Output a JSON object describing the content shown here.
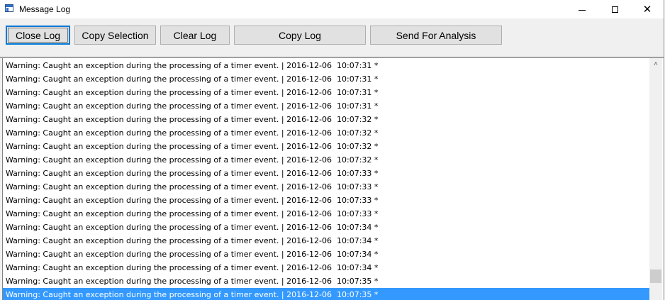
{
  "window": {
    "title": "Message Log",
    "controls": {
      "minimize": "minimize",
      "maximize": "maximize",
      "close": "✕"
    }
  },
  "toolbar": {
    "close_log": "Close Log",
    "copy_selection": "Copy Selection",
    "clear_log": "Clear Log",
    "copy_log": "Copy Log",
    "send_for_analysis": "Send For Analysis"
  },
  "log": {
    "selected_index": 17,
    "entries": [
      "Warning: Caught an exception during the processing of a timer event. | 2016-12-06  10:07:31 *",
      "Warning: Caught an exception during the processing of a timer event. | 2016-12-06  10:07:31 *",
      "Warning: Caught an exception during the processing of a timer event. | 2016-12-06  10:07:31 *",
      "Warning: Caught an exception during the processing of a timer event. | 2016-12-06  10:07:31 *",
      "Warning: Caught an exception during the processing of a timer event. | 2016-12-06  10:07:32 *",
      "Warning: Caught an exception during the processing of a timer event. | 2016-12-06  10:07:32 *",
      "Warning: Caught an exception during the processing of a timer event. | 2016-12-06  10:07:32 *",
      "Warning: Caught an exception during the processing of a timer event. | 2016-12-06  10:07:32 *",
      "Warning: Caught an exception during the processing of a timer event. | 2016-12-06  10:07:33 *",
      "Warning: Caught an exception during the processing of a timer event. | 2016-12-06  10:07:33 *",
      "Warning: Caught an exception during the processing of a timer event. | 2016-12-06  10:07:33 *",
      "Warning: Caught an exception during the processing of a timer event. | 2016-12-06  10:07:33 *",
      "Warning: Caught an exception during the processing of a timer event. | 2016-12-06  10:07:34 *",
      "Warning: Caught an exception during the processing of a timer event. | 2016-12-06  10:07:34 *",
      "Warning: Caught an exception during the processing of a timer event. | 2016-12-06  10:07:34 *",
      "Warning: Caught an exception during the processing of a timer event. | 2016-12-06  10:07:34 *",
      "Warning: Caught an exception during the processing of a timer event. | 2016-12-06  10:07:35 *",
      "Warning: Caught an exception during the processing of a timer event. | 2016-12-06  10:07:35 *"
    ]
  },
  "icons": {
    "app": "app-window-icon",
    "scroll_up": "chevron-up-icon"
  },
  "colors": {
    "selection": "#3399ff",
    "default_button_border": "#0078d7"
  }
}
